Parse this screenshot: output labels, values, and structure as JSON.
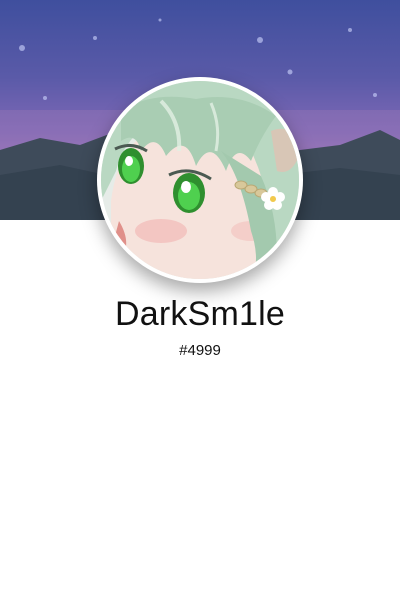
{
  "profile": {
    "username": "DarkSm1le",
    "discriminator": "#4999",
    "avatar_icon": "anime-avatar-icon",
    "banner_icon": "night-sky-banner-icon"
  },
  "colors": {
    "banner_top": "#3f4f9e",
    "banner_mid": "#7e68b6",
    "mountains": "#3e4b5a",
    "hair": "#b8d6c0",
    "eyes": "#3fbf3f",
    "text": "#111111",
    "background": "#ffffff"
  }
}
